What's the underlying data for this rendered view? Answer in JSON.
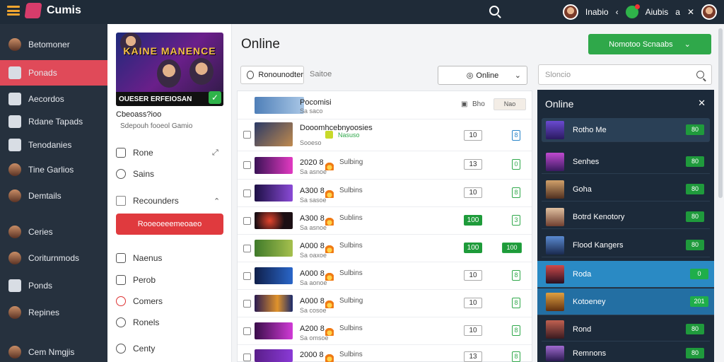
{
  "app": {
    "title": "Cumis"
  },
  "topbar": {
    "user1": "Inabio",
    "user2": "Aiubis",
    "user3": "a",
    "close": "✕"
  },
  "nav": {
    "items": [
      {
        "label": "Betomoner"
      },
      {
        "label": "Ponads"
      },
      {
        "label": "Aecordos"
      },
      {
        "label": "Rdane Tapads"
      },
      {
        "label": "Tenodanies"
      },
      {
        "label": "Tine Garlios"
      },
      {
        "label": "Demtails"
      },
      {
        "label": "Ceries"
      },
      {
        "label": "Coriturnmods"
      },
      {
        "label": "Ponds"
      },
      {
        "label": "Repines"
      },
      {
        "label": "Cem Nmgjis"
      }
    ]
  },
  "col2": {
    "cover_title": "KAINE MANENCE",
    "cover_sub": "OUESER ERFEIOSAN",
    "meta1": "Cbeoass?ioo",
    "meta2": "Sdepouh fooeol Gamio",
    "items": [
      {
        "label": "Rone"
      },
      {
        "label": "Sains"
      },
      {
        "label": "Recounders"
      },
      {
        "label": "Naenus"
      },
      {
        "label": "Perob"
      },
      {
        "label": "Comers"
      },
      {
        "label": "Ronels"
      },
      {
        "label": "Centy"
      }
    ],
    "red_button": "Rooeoeeemeoaeo"
  },
  "main": {
    "title": "Online",
    "green_button": "Nomotoo Scnaabs",
    "filter_label": "Ronounodter",
    "filter_text": "Saitoe",
    "select_value": "Online",
    "search_placeholder": "Sloncio"
  },
  "rows": [
    {
      "name": "Pocomisi",
      "sub": "Sa saco",
      "status": "",
      "badge": "Bho",
      "mini": "Nao"
    },
    {
      "name": "Dooomhcebnyoosies",
      "sub": "Sooeso",
      "status": "Nasuso",
      "badge": "10",
      "mini": "8"
    },
    {
      "name": "2020 8",
      "sub": "Sa asnoe",
      "status": "Sulbing",
      "badge": "13",
      "mini": "0"
    },
    {
      "name": "A300 8",
      "sub": "Sa sasoe",
      "status": "Sulbins",
      "badge": "10",
      "mini": "8"
    },
    {
      "name": "A300 8",
      "sub": "Sa asnoe",
      "status": "Sublins",
      "badge": "100",
      "mini": "3"
    },
    {
      "name": "A000 8",
      "sub": "Sa oaxoe",
      "status": "Sulbins",
      "badge": "100",
      "mini": "100"
    },
    {
      "name": "A000 8",
      "sub": "Sa aonoe",
      "status": "Sulbins",
      "badge": "10",
      "mini": "8"
    },
    {
      "name": "A000 8",
      "sub": "Sa cosoe",
      "status": "Sulbing",
      "badge": "10",
      "mini": "8"
    },
    {
      "name": "A200 8",
      "sub": "Sa omsoe",
      "status": "Sulbins",
      "badge": "10",
      "mini": "8"
    },
    {
      "name": "2000 8",
      "sub": "",
      "status": "Sulbins",
      "badge": "13",
      "mini": "8"
    }
  ],
  "panel": {
    "title": "Online",
    "items": [
      {
        "label": "Rotho Me",
        "count": "80"
      },
      {
        "label": "Senhes",
        "count": "80"
      },
      {
        "label": "Goha",
        "count": "80"
      },
      {
        "label": "Botrd Kenotory",
        "count": "80"
      },
      {
        "label": "Flood Kangers",
        "count": "80"
      },
      {
        "label": "Roda",
        "count": "0"
      },
      {
        "label": "Kotoeney",
        "count": "201"
      },
      {
        "label": "Rond",
        "count": "80"
      },
      {
        "label": "Remnons",
        "count": "80"
      }
    ]
  },
  "colors": {
    "accent_red": "#e04a59",
    "accent_green": "#2fa84a",
    "panel_bg": "#1c2a3a",
    "nav_bg": "#26313e"
  }
}
